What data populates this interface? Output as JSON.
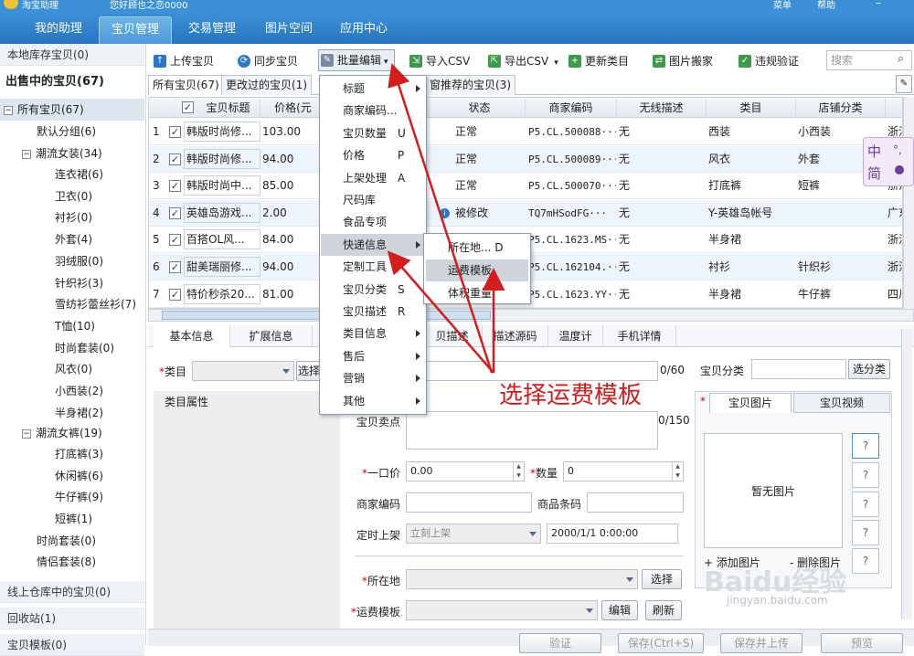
{
  "titlebar": {
    "app": "淘宝助理",
    "greeting": "您好顾也之恋0000",
    "menu": "菜单",
    "help": "帮助"
  },
  "nav": {
    "tabs": [
      "我的助理",
      "宝贝管理",
      "交易管理",
      "图片空间",
      "应用中心"
    ],
    "active": 1
  },
  "sidebar": {
    "local": "本地库存宝贝(0)",
    "onsale": "出售中的宝贝(67)",
    "all": "所有宝贝(67)",
    "default_group": "默认分组(6)",
    "group1": "潮流女装(34)",
    "group1_items": [
      "连衣裙(6)",
      "卫衣(0)",
      "衬衫(0)",
      "外套(4)",
      "羽绒服(0)",
      "针织衫(3)",
      "雪纺衫蕾丝衫(7)",
      "T恤(10)",
      "时尚套装(0)",
      "风衣(0)",
      "小西装(2)",
      "半身裙(2)"
    ],
    "group2": "潮流女裤(19)",
    "group2_items": [
      "打底裤(3)",
      "休闲裤(6)",
      "牛仔裤(9)",
      "短裤(1)"
    ],
    "tail_items": [
      "时尚套装(0)",
      "情侣套装(8)"
    ],
    "warehouse": "线上仓库中的宝贝(0)",
    "recycle": "回收站(1)",
    "template": "宝贝模板(0)"
  },
  "toolbar": {
    "upload": "上传宝贝",
    "sync": "同步宝贝",
    "batch_edit": "批量编辑",
    "import_csv": "导入CSV",
    "export_csv": "导出CSV",
    "update_category": "更新类目",
    "image_move": "图片搬家",
    "violation": "违规验证",
    "search_placeholder": "搜索"
  },
  "subtabs": [
    "所有宝贝(67)",
    "更改过的宝贝(1)",
    "窗推荐的宝贝(3)"
  ],
  "grid": {
    "headers": [
      "宝贝标题",
      "价格(元",
      "状态",
      "商家编码",
      "无线描述",
      "类目",
      "店铺分类"
    ],
    "rows": [
      {
        "n": "1",
        "title": "韩版时尚修...",
        "price": "103.00",
        "status": "正常",
        "code": "P5.CL.500088···",
        "wireless": "无",
        "cat": "西装",
        "shop": "小西装",
        "loc": "浙江"
      },
      {
        "n": "2",
        "title": "韩版时尚修...",
        "price": "94.00",
        "status": "正常",
        "code": "P5.CL.500089···",
        "wireless": "无",
        "cat": "风衣",
        "shop": "外套",
        "loc": "浙江"
      },
      {
        "n": "3",
        "title": "韩版时尚中...",
        "price": "85.00",
        "status": "正常",
        "code": "P5.CL.500070···",
        "wireless": "无",
        "cat": "打底裤",
        "shop": "短裤",
        "loc": "浙江"
      },
      {
        "n": "4",
        "title": "英雄岛游戏...",
        "price": "2.00",
        "status": "被修改",
        "code": "TQ7mHSodFG···",
        "wireless": "无",
        "cat": "Y-英雄岛帐号",
        "shop": "",
        "loc": "广东"
      },
      {
        "n": "5",
        "title": "百搭OL风...",
        "price": "84.00",
        "status": "",
        "code": "P5.CL.1623.MS···",
        "wireless": "无",
        "cat": "半身裙",
        "shop": "",
        "loc": "浙江"
      },
      {
        "n": "6",
        "title": "甜美瑞丽修...",
        "price": "94.00",
        "status": "",
        "code": "P5.CL.162104.···",
        "wireless": "无",
        "cat": "衬衫",
        "shop": "针织衫",
        "loc": "浙江"
      },
      {
        "n": "7",
        "title": "特价秒杀20...",
        "price": "81.00",
        "status": "",
        "code": "P5.CL.1623.YY···",
        "wireless": "无",
        "cat": "半身裙",
        "shop": "牛仔裤",
        "loc": "四川"
      }
    ]
  },
  "ime": {
    "a": "中",
    "b": "简"
  },
  "bottom_tabs": [
    "基本信息",
    "扩展信息",
    "贝描述",
    "描述源码",
    "温度计",
    "手机详情"
  ],
  "form": {
    "category": "类目",
    "choose": "选择",
    "cat_attr": "类目属性",
    "counter1": "0/60",
    "selling": "宝贝卖点",
    "counter2": "0/150",
    "price_label": "一口价",
    "price_val": "0.00",
    "qty_label": "数量",
    "qty_val": "0",
    "code_label": "商家编码",
    "barcode_label": "商品条码",
    "schedule_label": "定时上架",
    "schedule_val": "立刻上架",
    "date_val": "2000/1/1 0:00:00",
    "location_label": "所在地",
    "location_btn": "选择",
    "freight_label": "运费模板",
    "edit_btn": "编辑",
    "refresh_btn": "刷新",
    "shop_cat_label": "宝贝分类",
    "shop_cat_btn": "选分类",
    "img_tab": "宝贝图片",
    "video_tab": "宝贝视频",
    "no_image": "暂无图片",
    "add_image": "+ 添加图片",
    "del_image": "- 删除图片",
    "q": "?"
  },
  "bottombar": {
    "verify": "验证",
    "save": "保存(Ctrl+S)",
    "save_upload": "保存并上传",
    "preview": "预览"
  },
  "menu": {
    "items": [
      {
        "label": "标题",
        "acc": "",
        "arrow": true
      },
      {
        "label": "商家编码...",
        "acc": "",
        "arrow": false
      },
      {
        "label": "宝贝数量",
        "acc": "U",
        "arrow": false
      },
      {
        "label": "价格",
        "acc": "P",
        "arrow": false
      },
      {
        "label": "上架处理",
        "acc": "A",
        "arrow": false
      },
      {
        "label": "尺码库",
        "acc": "",
        "arrow": false
      },
      {
        "label": "食品专项",
        "acc": "",
        "arrow": false
      },
      {
        "label": "快递信息",
        "acc": "",
        "arrow": true
      },
      {
        "label": "定制工具",
        "acc": "",
        "arrow": false
      },
      {
        "label": "宝贝分类",
        "acc": "S",
        "arrow": false
      },
      {
        "label": "宝贝描述",
        "acc": "R",
        "arrow": false
      },
      {
        "label": "类目信息",
        "acc": "",
        "arrow": true
      },
      {
        "label": "售后",
        "acc": "",
        "arrow": true
      },
      {
        "label": "营销",
        "acc": "",
        "arrow": true
      },
      {
        "label": "其他",
        "acc": "",
        "arrow": true
      }
    ],
    "hover_index": 7
  },
  "submenu": {
    "items": [
      "所在地... D",
      "运费模板",
      "体积重量"
    ],
    "hover_index": 1
  },
  "annotation": "选择运费模板",
  "watermark": {
    "logo": "Baidu经验",
    "url": "jingyan.baidu.com"
  },
  "colors": {
    "nav": "#2d7cc8",
    "annotation": "#d41d1d",
    "highlight": "#cfd4da"
  }
}
